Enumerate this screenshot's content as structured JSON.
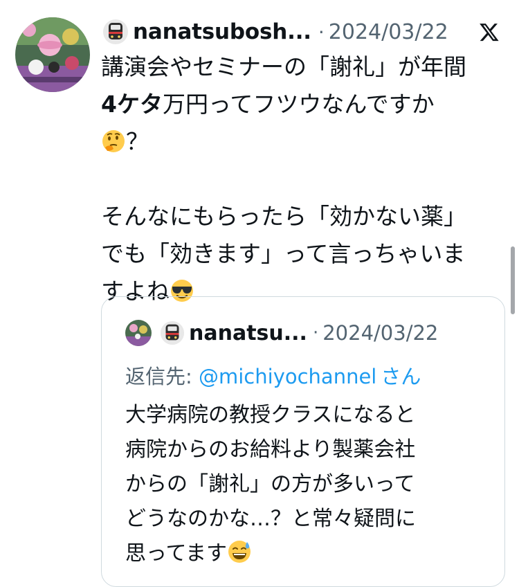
{
  "tweet": {
    "author": "nanatsubosh...",
    "separator": "·",
    "date": "2024/03/22",
    "body": {
      "line1": "講演会やセミナーの「謝礼」が年間",
      "line2_bold": "4ケタ",
      "line2_rest": "万円ってフツウなんですか",
      "line3": "？",
      "line4": "そんなにもらったら「効かない薬」",
      "line5": "でも「効きます」って言っちゃいま",
      "line6": "すよね"
    },
    "emojis": [
      "thinking-face",
      "sunglasses-face"
    ]
  },
  "quoted_tweet": {
    "author": "nanatsu...",
    "separator": "·",
    "date": "2024/03/22",
    "reply_label": "返信先: ",
    "reply_handle": "@michiyochannel",
    "reply_suffix": "さん",
    "body": {
      "line1": "大学病院の教授クラスになると",
      "line2": "病院からのお給料より製薬会社",
      "line3": "からの「謝礼」の方が多いって",
      "line4": "どうなのかな…？と常々疑問に",
      "line5": "思ってます"
    },
    "emojis": [
      "sweat-smile-face"
    ]
  },
  "icons": {
    "platform_logo": "x-logo",
    "name_badge": "train-icon"
  },
  "colors": {
    "text": "#0f1419",
    "secondary": "#536471",
    "link": "#1d9bf0",
    "border": "#cfd9de"
  }
}
